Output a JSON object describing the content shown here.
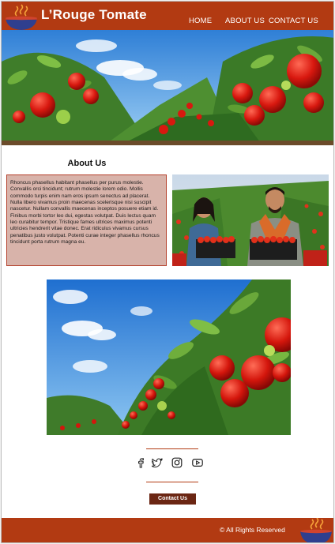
{
  "header": {
    "brand": "L’Rouge Tomate",
    "logo_icon": "steaming-soup-bowl-icon",
    "nav": [
      {
        "label": "HOME"
      },
      {
        "label": "ABOUT US"
      },
      {
        "label": "CONTACT US"
      }
    ]
  },
  "about": {
    "heading": "About Us",
    "body": "Rhoncus phasellus habitant phasellus per purus molestie. Convallis orci tincidunt; rutrum molestie lorem odio. Mollis commodo turpis enim nam eros ipsum senectus ad placerat. Nulla libero vivamus proin maecenas scelerisque nisi suscipit nascetur. Nullam convallis maecenas inceptos posuere etiam id. Finibus morbi tortor leo dui, egestas volutpat. Duis lectus quam leo curabitur tempor. Tristique fames ultrices maximus potenti ultricies hendrerit vitae donec. Erat ridiculus vivamus cursus penatibus justo volutpat. Potenti curae integer phasellus rhoncus tincidunt porta rutrum magna eu."
  },
  "social": {
    "icons": [
      "facebook-icon",
      "twitter-icon",
      "instagram-icon",
      "youtube-icon"
    ]
  },
  "cta": {
    "label": "Contact Us"
  },
  "footer": {
    "copyright": "© All Rights Reserved"
  },
  "colors": {
    "brand": "#b23a12",
    "button": "#6b2613",
    "about_box_bg": "#d8b3aa",
    "about_box_border": "#b43f2a"
  }
}
